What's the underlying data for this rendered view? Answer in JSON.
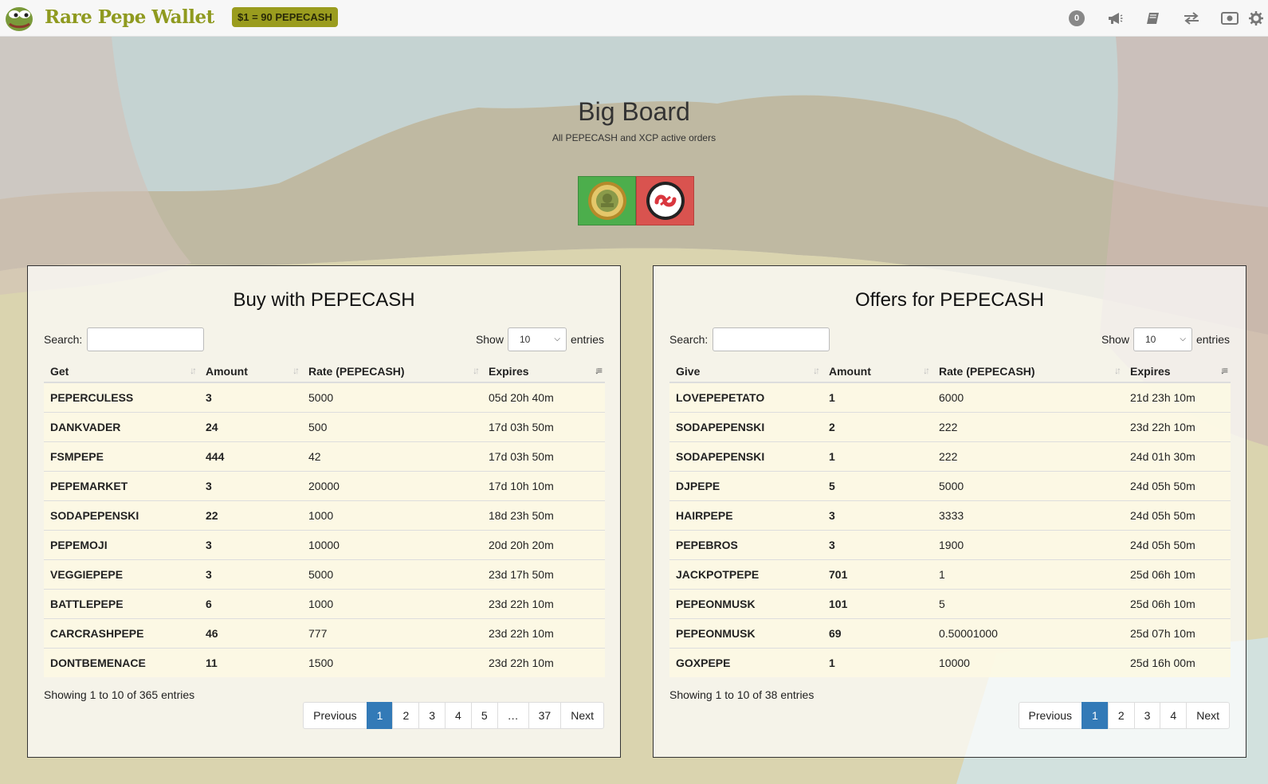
{
  "navbar": {
    "brand": "Rare Pepe Wallet",
    "rate_badge": "$1 = 90 PEPECASH",
    "notification_count": "0",
    "icons": [
      "notifications-count",
      "megaphone-icon",
      "book-icon",
      "exchange-icon",
      "money-icon",
      "gear-icon"
    ]
  },
  "header": {
    "title": "Big Board",
    "subtitle": "All PEPECASH and XCP active orders"
  },
  "currency_buttons": [
    {
      "name": "PEPECASH",
      "color": "#4cae4c"
    },
    {
      "name": "XCP",
      "color": "#d9534f"
    }
  ],
  "buy_panel": {
    "title": "Buy with PEPECASH",
    "search_label": "Search:",
    "show_label": "Show",
    "show_value": "10",
    "entries_label": "entries",
    "columns": [
      "Get",
      "Amount",
      "Rate (PEPECASH)",
      "Expires"
    ],
    "rows": [
      [
        "PEPERCULESS",
        "3",
        "5000",
        "05d 20h 40m"
      ],
      [
        "DANKVADER",
        "24",
        "500",
        "17d 03h 50m"
      ],
      [
        "FSMPEPE",
        "444",
        "42",
        "17d 03h 50m"
      ],
      [
        "PEPEMARKET",
        "3",
        "20000",
        "17d 10h 10m"
      ],
      [
        "SODAPEPENSKI",
        "22",
        "1000",
        "18d 23h 50m"
      ],
      [
        "PEPEMOJI",
        "3",
        "10000",
        "20d 20h 20m"
      ],
      [
        "VEGGIEPEPE",
        "3",
        "5000",
        "23d 17h 50m"
      ],
      [
        "BATTLEPEPE",
        "6",
        "1000",
        "23d 22h 10m"
      ],
      [
        "CARCRASHPEPE",
        "46",
        "777",
        "23d 22h 10m"
      ],
      [
        "DONTBEMENACE",
        "11",
        "1500",
        "23d 22h 10m"
      ]
    ],
    "info": "Showing 1 to 10 of 365 entries",
    "pager": [
      "Previous",
      "1",
      "2",
      "3",
      "4",
      "5",
      "…",
      "37",
      "Next"
    ],
    "active_page": "1"
  },
  "offers_panel": {
    "title": "Offers for PEPECASH",
    "search_label": "Search:",
    "show_label": "Show",
    "show_value": "10",
    "entries_label": "entries",
    "columns": [
      "Give",
      "Amount",
      "Rate (PEPECASH)",
      "Expires"
    ],
    "rows": [
      [
        "LOVEPEPETATO",
        "1",
        "6000",
        "21d 23h 10m"
      ],
      [
        "SODAPEPENSKI",
        "2",
        "222",
        "23d 22h 10m"
      ],
      [
        "SODAPEPENSKI",
        "1",
        "222",
        "24d 01h 30m"
      ],
      [
        "DJPEPE",
        "5",
        "5000",
        "24d 05h 50m"
      ],
      [
        "HAIRPEPE",
        "3",
        "3333",
        "24d 05h 50m"
      ],
      [
        "PEPEBROS",
        "3",
        "1900",
        "24d 05h 50m"
      ],
      [
        "JACKPOTPEPE",
        "701",
        "1",
        "25d 06h 10m"
      ],
      [
        "PEPEONMUSK",
        "101",
        "5",
        "25d 06h 10m"
      ],
      [
        "PEPEONMUSK",
        "69",
        "0.50001000",
        "25d 07h 10m"
      ],
      [
        "GOXPEPE",
        "1",
        "10000",
        "25d 16h 00m"
      ]
    ],
    "info": "Showing 1 to 10 of 38 entries",
    "pager": [
      "Previous",
      "1",
      "2",
      "3",
      "4",
      "Next"
    ],
    "active_page": "1"
  }
}
